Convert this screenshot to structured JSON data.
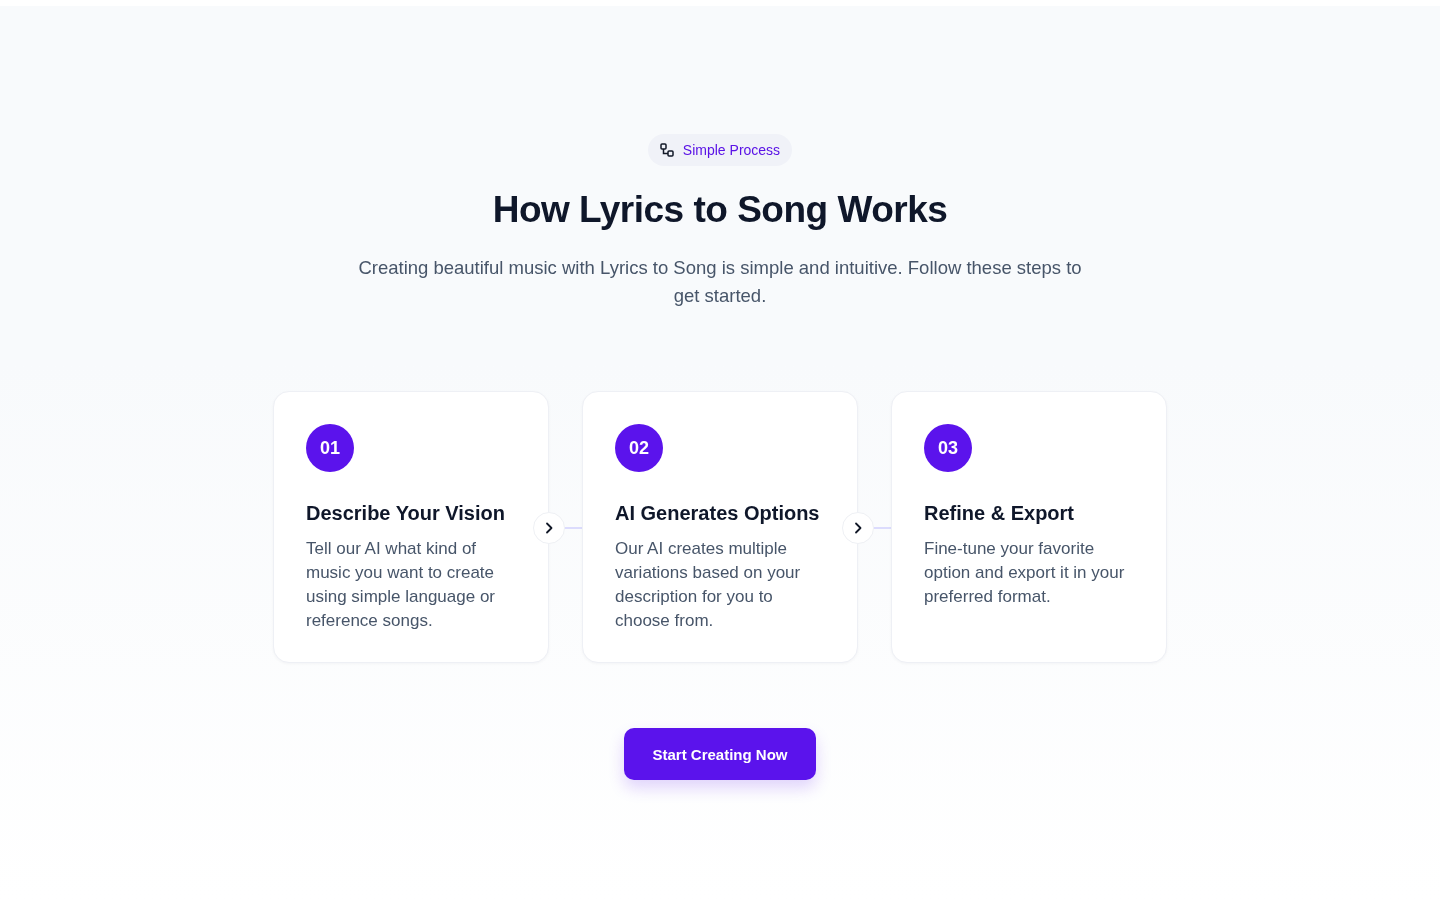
{
  "badge": {
    "label": "Simple Process"
  },
  "heading": "How Lyrics to Song Works",
  "intro": "Creating beautiful music with Lyrics to Song is simple and intuitive. Follow these steps to get started.",
  "steps": [
    {
      "number": "01",
      "title": "Describe Your Vision",
      "description": "Tell our AI what kind of music you want to create using simple language or reference songs."
    },
    {
      "number": "02",
      "title": "AI Generates Options",
      "description": "Our AI creates multiple variations based on your description for you to choose from."
    },
    {
      "number": "03",
      "title": "Refine & Export",
      "description": "Fine-tune your favorite option and export it in your preferred format."
    }
  ],
  "cta": {
    "label": "Start Creating Now"
  }
}
